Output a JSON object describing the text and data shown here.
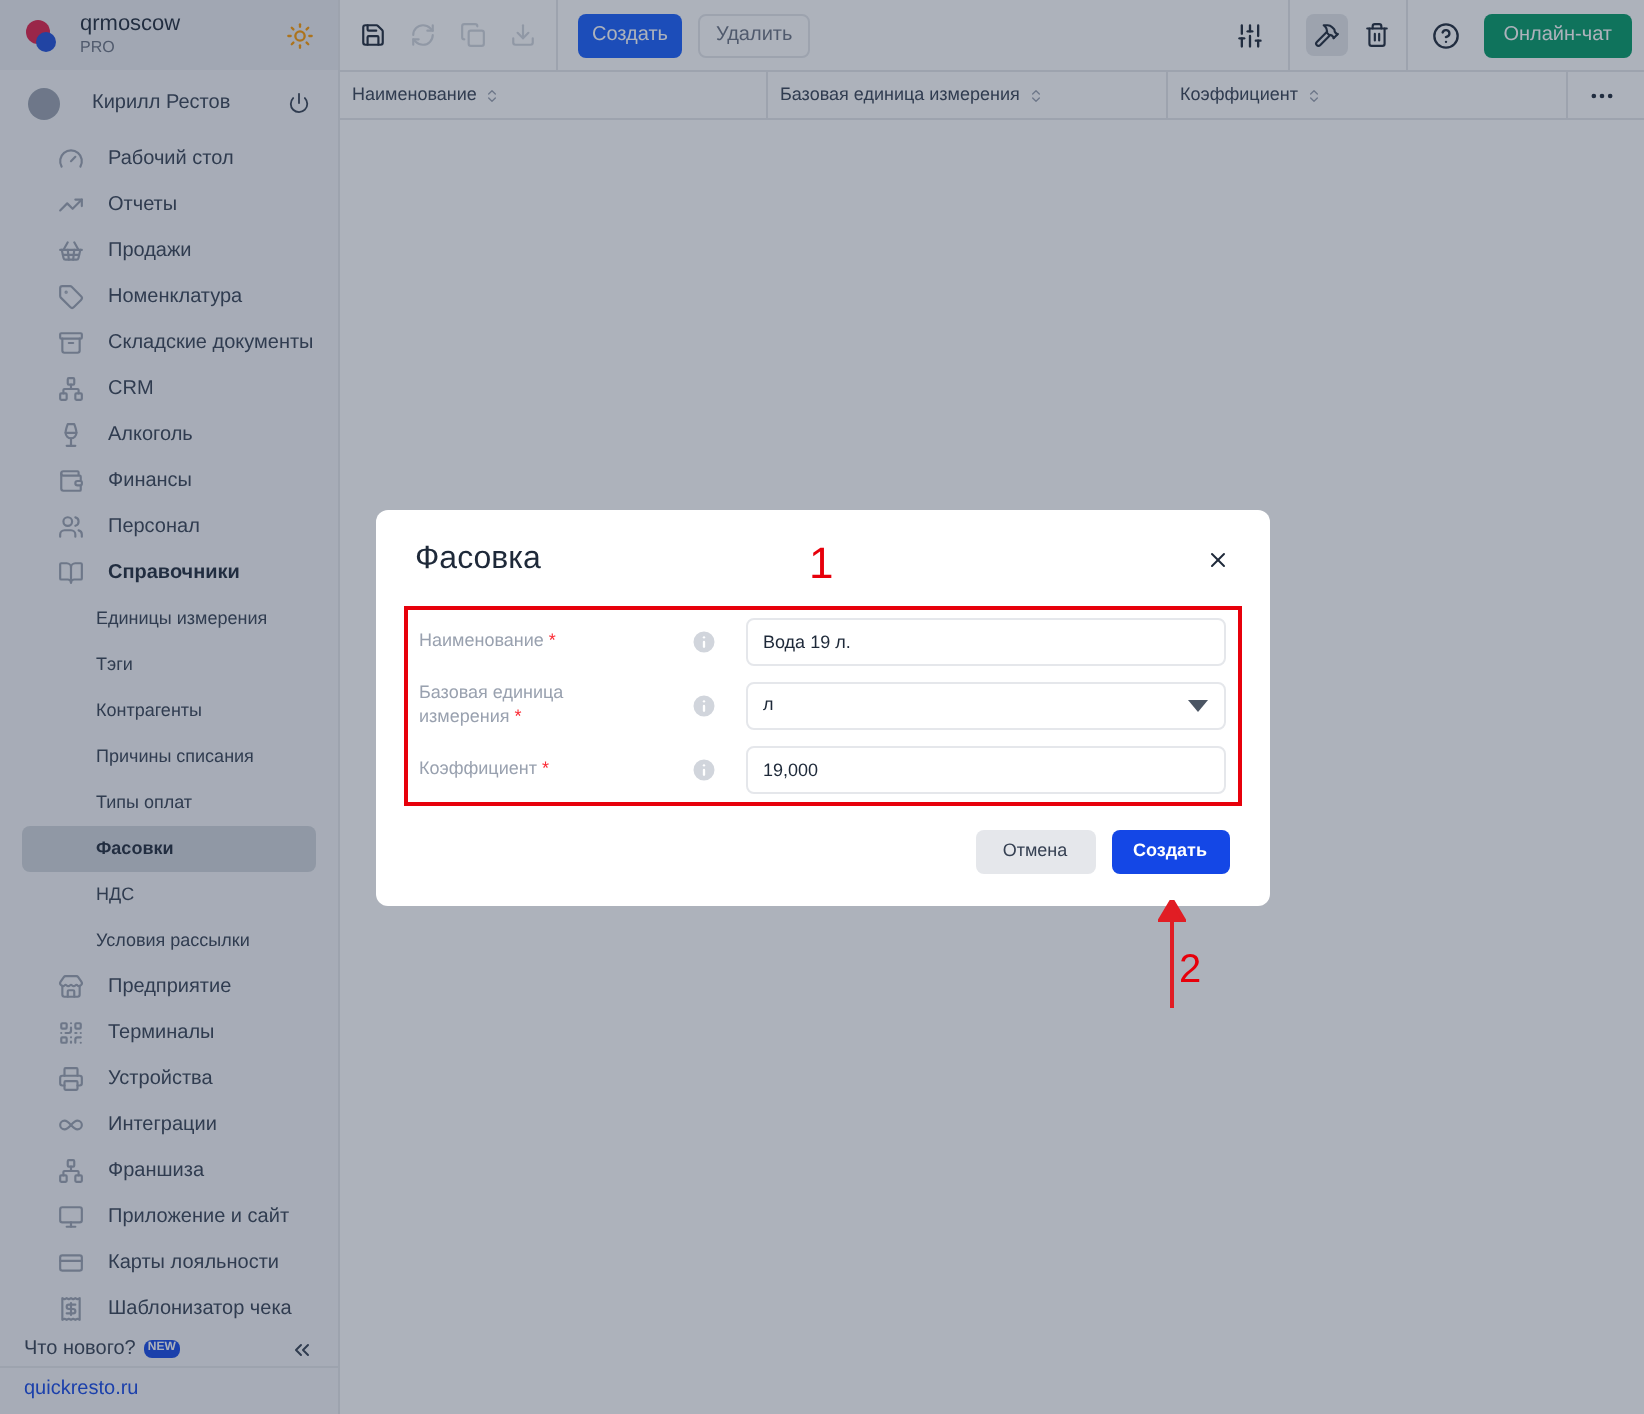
{
  "brand": {
    "name": "qrmoscow",
    "plan": "PRO"
  },
  "user": {
    "name": "Кирилл Рестов"
  },
  "nav": [
    {
      "label": "Рабочий стол",
      "selected": false
    },
    {
      "label": "Отчеты",
      "selected": false
    },
    {
      "label": "Продажи",
      "selected": false
    },
    {
      "label": "Номенклатура",
      "selected": false
    },
    {
      "label": "Складские документы",
      "selected": false
    },
    {
      "label": "CRM",
      "selected": false
    },
    {
      "label": "Алкоголь",
      "selected": false
    },
    {
      "label": "Финансы",
      "selected": false
    },
    {
      "label": "Персонал",
      "selected": false
    },
    {
      "label": "Справочники",
      "selected": false,
      "expanded": true,
      "children": [
        {
          "label": "Единицы измерения",
          "selected": false
        },
        {
          "label": "Тэги",
          "selected": false
        },
        {
          "label": "Контрагенты",
          "selected": false
        },
        {
          "label": "Причины списания",
          "selected": false
        },
        {
          "label": "Типы оплат",
          "selected": false
        },
        {
          "label": "Фасовки",
          "selected": true
        },
        {
          "label": "НДС",
          "selected": false
        },
        {
          "label": "Условия рассылки",
          "selected": false
        }
      ]
    },
    {
      "label": "Предприятие",
      "selected": false
    },
    {
      "label": "Терминалы",
      "selected": false
    },
    {
      "label": "Устройства",
      "selected": false
    },
    {
      "label": "Интеграции",
      "selected": false
    },
    {
      "label": "Франшиза",
      "selected": false
    },
    {
      "label": "Приложение и сайт",
      "selected": false
    },
    {
      "label": "Карты лояльности",
      "selected": false
    },
    {
      "label": "Шаблонизатор чека",
      "selected": false
    }
  ],
  "whats_new": {
    "label": "Что нового?",
    "badge": "NEW"
  },
  "footer_link": "quickresto.ru",
  "toolbar": {
    "icons": [
      {
        "disabled": false
      },
      {
        "disabled": true
      },
      {
        "disabled": true
      },
      {
        "disabled": true
      }
    ],
    "create": "Создать",
    "delete": {
      "label": "Удалить",
      "disabled": true
    },
    "tools_active": true,
    "chat": "Онлайн-чат"
  },
  "table": {
    "columns": [
      "Наименование",
      "Базовая единица измерения",
      "Коэффициент"
    ]
  },
  "dialog": {
    "title": "Фасовка",
    "fields": [
      {
        "kind": "input",
        "label": "Наименование",
        "required_mark": "*",
        "value": "Вода 19 л."
      },
      {
        "kind": "select",
        "label": "Базовая единица измерения",
        "required_mark": "*",
        "value": "л"
      },
      {
        "kind": "input",
        "label": "Коэффициент",
        "required_mark": "*",
        "value": "19,000"
      }
    ],
    "cancel": "Отмена",
    "submit": "Создать"
  },
  "annotations": [
    {
      "label": "1"
    },
    {
      "label": "2"
    }
  ]
}
